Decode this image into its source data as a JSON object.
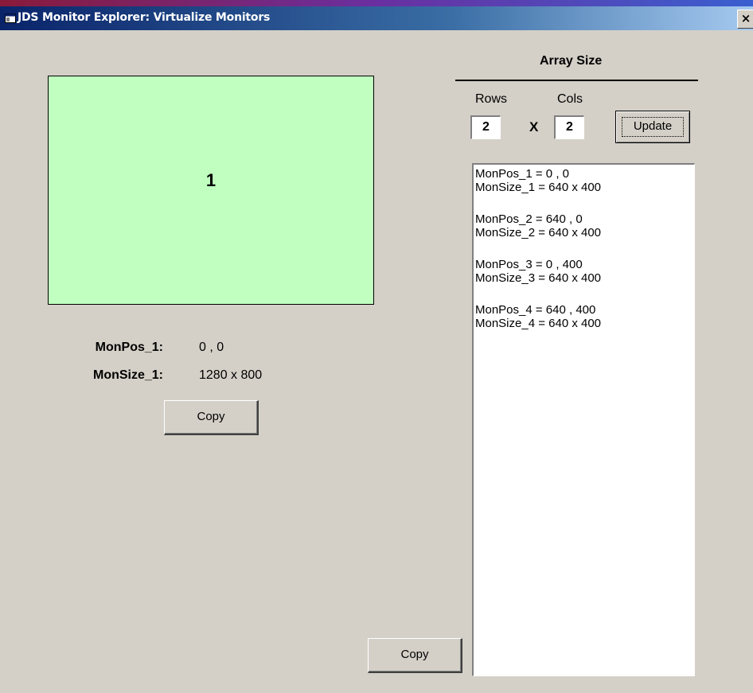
{
  "window": {
    "title": "JDS Monitor Explorer: Virtualize Monitors",
    "close_label": "×"
  },
  "monitor": {
    "label": "1",
    "fill_color": "#c0ffc0"
  },
  "info": {
    "pos_key": "MonPos_1:",
    "pos_value": "0 , 0",
    "size_key": "MonSize_1:",
    "size_value": "1280 x 800"
  },
  "copy_button_left": "Copy",
  "copy_button_bottom": "Copy",
  "array": {
    "title": "Array Size",
    "rows_label": "Rows",
    "cols_label": "Cols",
    "rows_value": "2",
    "cols_value": "2",
    "x_symbol": "X",
    "update_label": "Update"
  },
  "list": [
    {
      "pos": "MonPos_1 = 0 , 0",
      "size": "MonSize_1 = 640 x 400"
    },
    {
      "pos": "MonPos_2 = 640 , 0",
      "size": "MonSize_2 = 640 x 400"
    },
    {
      "pos": "MonPos_3 = 0 , 400",
      "size": "MonSize_3 = 640 x 400"
    },
    {
      "pos": "MonPos_4 = 640 , 400",
      "size": "MonSize_4 = 640 x 400"
    }
  ]
}
